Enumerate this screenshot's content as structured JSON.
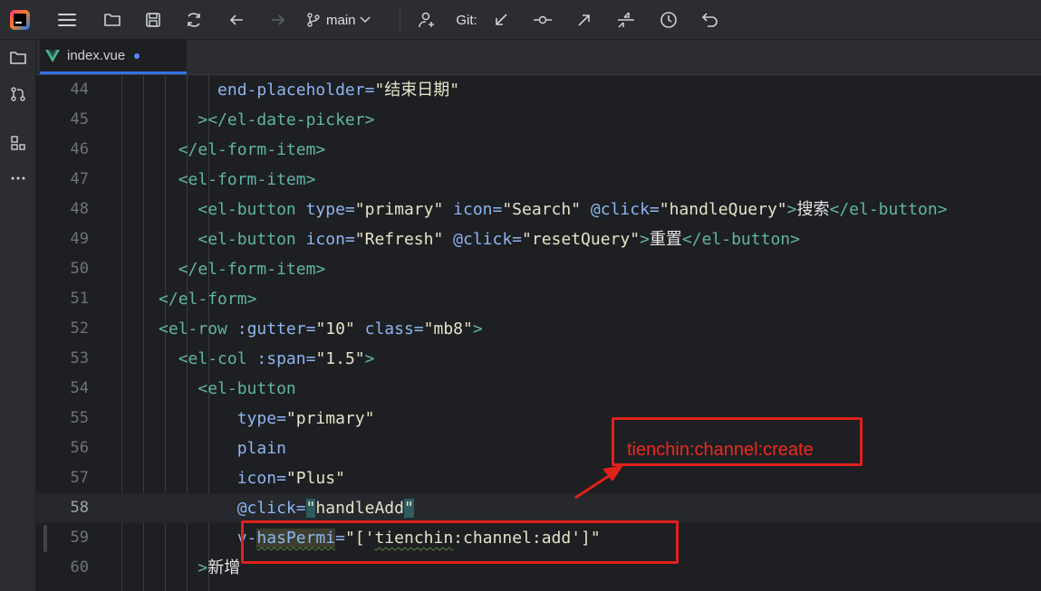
{
  "toolbar": {
    "branch": "main",
    "git_label": "Git:"
  },
  "tab": {
    "filename": "index.vue"
  },
  "lines": [
    {
      "n": "44",
      "indent": "      ",
      "parts": [
        [
          "attr",
          "end-placeholder="
        ],
        [
          "str",
          "\"结束日期\""
        ]
      ]
    },
    {
      "n": "45",
      "indent": "    ",
      "parts": [
        [
          "tag",
          "></el-date-picker>"
        ]
      ]
    },
    {
      "n": "46",
      "indent": "  ",
      "parts": [
        [
          "tag",
          "</el-form-item>"
        ]
      ]
    },
    {
      "n": "47",
      "indent": "  ",
      "parts": [
        [
          "tag",
          "<el-form-item>"
        ]
      ]
    },
    {
      "n": "48",
      "indent": "    ",
      "parts": [
        [
          "tag",
          "<el-button "
        ],
        [
          "attr",
          "type="
        ],
        [
          "str",
          "\"primary\" "
        ],
        [
          "attr",
          "icon="
        ],
        [
          "str",
          "\"Search\" "
        ],
        [
          "attr",
          "@click="
        ],
        [
          "str",
          "\"handleQuery\""
        ],
        [
          "tag",
          ">"
        ],
        [
          "text",
          "搜索"
        ],
        [
          "tag",
          "</el-button>"
        ]
      ]
    },
    {
      "n": "49",
      "indent": "    ",
      "parts": [
        [
          "tag",
          "<el-button "
        ],
        [
          "attr",
          "icon="
        ],
        [
          "str",
          "\"Refresh\" "
        ],
        [
          "attr",
          "@click="
        ],
        [
          "str",
          "\"resetQuery\""
        ],
        [
          "tag",
          ">"
        ],
        [
          "text",
          "重置"
        ],
        [
          "tag",
          "</el-button>"
        ]
      ]
    },
    {
      "n": "50",
      "indent": "  ",
      "parts": [
        [
          "tag",
          "</el-form-item>"
        ]
      ]
    },
    {
      "n": "51",
      "indent": "",
      "parts": [
        [
          "tag",
          "</el-form>"
        ]
      ]
    },
    {
      "n": "52",
      "indent": "",
      "parts": [
        [
          "tag",
          "<el-row "
        ],
        [
          "attr",
          ":gutter="
        ],
        [
          "str",
          "\"10\" "
        ],
        [
          "attr",
          "class="
        ],
        [
          "str",
          "\"mb8\""
        ],
        [
          "tag",
          ">"
        ]
      ]
    },
    {
      "n": "53",
      "indent": "  ",
      "parts": [
        [
          "tag",
          "<el-col "
        ],
        [
          "attr",
          ":span="
        ],
        [
          "str",
          "\"1.5\""
        ],
        [
          "tag",
          ">"
        ]
      ]
    },
    {
      "n": "54",
      "indent": "    ",
      "parts": [
        [
          "tag",
          "<el-button"
        ]
      ]
    },
    {
      "n": "55",
      "indent": "        ",
      "parts": [
        [
          "attr",
          "type="
        ],
        [
          "str",
          "\"primary\""
        ]
      ]
    },
    {
      "n": "56",
      "indent": "        ",
      "parts": [
        [
          "attr",
          "plain"
        ]
      ]
    },
    {
      "n": "57",
      "indent": "        ",
      "parts": [
        [
          "attr",
          "icon="
        ],
        [
          "str",
          "\"Plus\""
        ]
      ]
    },
    {
      "n": "58",
      "indent": "        ",
      "current": true,
      "parts": [
        [
          "attr",
          "@click="
        ],
        [
          "hlq",
          "\""
        ],
        [
          "str",
          "handleAdd"
        ],
        [
          "hlq",
          "\""
        ]
      ]
    },
    {
      "n": "59",
      "indent": "        ",
      "parts": [
        [
          "attr",
          "v-"
        ],
        [
          "hla",
          "hasPermi"
        ],
        [
          "attr",
          "="
        ],
        [
          "str",
          "\"['"
        ],
        [
          "strw",
          "tienchin"
        ],
        [
          "str",
          ":channel:add']\""
        ]
      ]
    },
    {
      "n": "60",
      "indent": "    ",
      "parts": [
        [
          "tag",
          ">"
        ],
        [
          "text",
          "新增"
        ]
      ]
    }
  ],
  "annotation": {
    "label": "tienchin:channel:create"
  }
}
